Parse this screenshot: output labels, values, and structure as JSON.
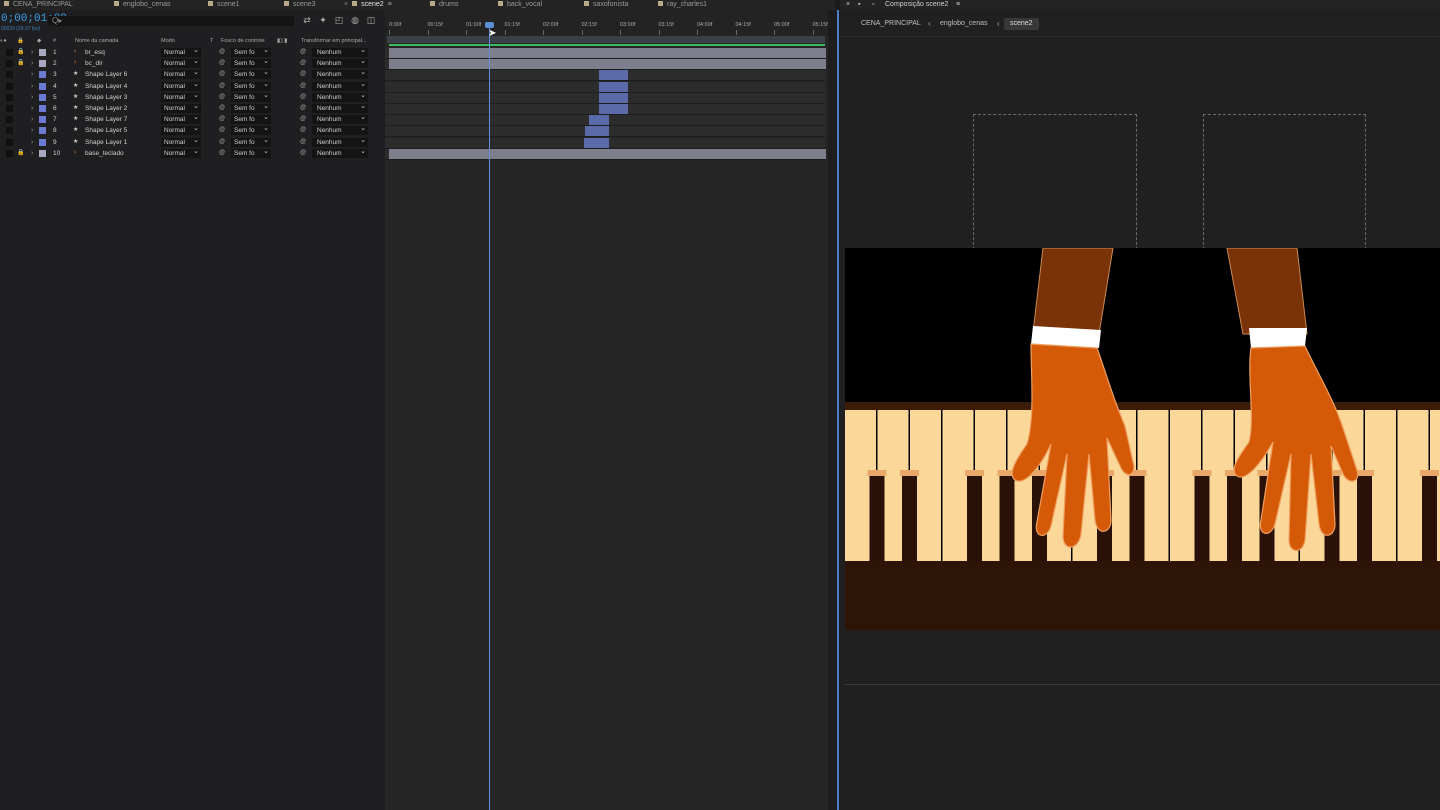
{
  "tabs": [
    {
      "label": "CENA_PRINCIPAL",
      "active": false,
      "close": false
    },
    {
      "label": "englobo_cenas",
      "active": false,
      "close": false
    },
    {
      "label": "scene1",
      "active": false,
      "close": false
    },
    {
      "label": "scene3",
      "active": false,
      "close": false
    },
    {
      "label": "scene2",
      "active": true,
      "close": true
    },
    {
      "label": "drums",
      "active": false,
      "close": false
    },
    {
      "label": "back_vocal",
      "active": false,
      "close": false
    },
    {
      "label": "saxofonista",
      "active": false,
      "close": false
    },
    {
      "label": "ray_charles1",
      "active": false,
      "close": false
    }
  ],
  "timecode": "0;00;01;09",
  "timecode_sub": "00039 (29.97 fps)",
  "search": {
    "icon": "search-icon",
    "placeholder": "Q▸"
  },
  "columns": {
    "name": "Nome da camada",
    "mode": "Modo",
    "t": "T",
    "track": "Fosco de controle",
    "parent": "Transformar em principal..."
  },
  "layers": [
    {
      "num": "1",
      "name": "br_esq",
      "type": "puppet",
      "locked": true,
      "label_color": "#a8a8c0",
      "mode": "Normal",
      "track": "Sem fo",
      "parent": "Nenhum"
    },
    {
      "num": "2",
      "name": "bc_dir",
      "type": "puppet",
      "locked": true,
      "label_color": "#a8a8c0",
      "mode": "Normal",
      "track": "Sem fo",
      "parent": "Nenhum"
    },
    {
      "num": "3",
      "name": "Shape Layer 6",
      "type": "shape",
      "locked": false,
      "label_color": "#6c7ad4",
      "mode": "Normal",
      "track": "Sem fo",
      "parent": "Nenhum"
    },
    {
      "num": "4",
      "name": "Shape Layer 4",
      "type": "shape",
      "locked": false,
      "label_color": "#6c7ad4",
      "mode": "Normal",
      "track": "Sem fo",
      "parent": "Nenhum"
    },
    {
      "num": "5",
      "name": "Shape Layer 3",
      "type": "shape",
      "locked": false,
      "label_color": "#6c7ad4",
      "mode": "Normal",
      "track": "Sem fo",
      "parent": "Nenhum"
    },
    {
      "num": "6",
      "name": "Shape Layer 2",
      "type": "shape",
      "locked": false,
      "label_color": "#6c7ad4",
      "mode": "Normal",
      "track": "Sem fo",
      "parent": "Nenhum"
    },
    {
      "num": "7",
      "name": "Shape Layer 7",
      "type": "shape",
      "locked": false,
      "label_color": "#6c7ad4",
      "mode": "Normal",
      "track": "Sem fo",
      "parent": "Nenhum"
    },
    {
      "num": "8",
      "name": "Shape Layer 5",
      "type": "shape",
      "locked": false,
      "label_color": "#6c7ad4",
      "mode": "Normal",
      "track": "Sem fo",
      "parent": "Nenhum"
    },
    {
      "num": "9",
      "name": "Shape Layer 1",
      "type": "shape",
      "locked": false,
      "label_color": "#6c7ad4",
      "mode": "Normal",
      "track": "Sem fo",
      "parent": "Nenhum"
    },
    {
      "num": "10",
      "name": "base_teclado",
      "type": "puppet",
      "locked": true,
      "label_color": "#a8a8c0",
      "mode": "Normal",
      "track": "Sem fo",
      "parent": "Nenhum"
    }
  ],
  "ruler_ticks": [
    "0:00f",
    "00:15f",
    "01:00f",
    "01:15f",
    "02:00f",
    "02:15f",
    "03:00f",
    "03:15f",
    "04:00f",
    "04:15f",
    "05:00f",
    "05:15f"
  ],
  "clips": [
    {
      "start_sec": 0,
      "end_sec": 5.67,
      "color": "#7d7f8c"
    },
    {
      "start_sec": 0,
      "end_sec": 5.67,
      "color": "#7d7f8c"
    },
    {
      "start_sec": 2.73,
      "end_sec": 3.1,
      "color": "#5b6aa8"
    },
    {
      "start_sec": 2.73,
      "end_sec": 3.1,
      "color": "#5b6aa8"
    },
    {
      "start_sec": 2.73,
      "end_sec": 3.1,
      "color": "#5b6aa8"
    },
    {
      "start_sec": 2.73,
      "end_sec": 3.1,
      "color": "#5b6aa8"
    },
    {
      "start_sec": 2.6,
      "end_sec": 2.86,
      "color": "#5b6aa8"
    },
    {
      "start_sec": 2.55,
      "end_sec": 2.86,
      "color": "#5b6aa8"
    },
    {
      "start_sec": 2.53,
      "end_sec": 2.86,
      "color": "#5b6aa8"
    },
    {
      "start_sec": 0,
      "end_sec": 5.67,
      "color": "#7d7f8c"
    }
  ],
  "playhead_sec": 1.3,
  "comp": {
    "panel_title": "Composição scene2",
    "breadcrumbs": [
      "CENA_PRINCIPAL",
      "englobo_cenas",
      "scene2"
    ]
  },
  "colors": {
    "accent": "#3aa0e6",
    "playhead": "#5c8fd8",
    "work_area": "#3db85a",
    "sleeve": "#7a3208",
    "hand": "#d45a08",
    "cuff": "#ffffff",
    "white_key": "#fbd89a",
    "black_key": "#2a1208",
    "piano_base": "#2e1405"
  }
}
